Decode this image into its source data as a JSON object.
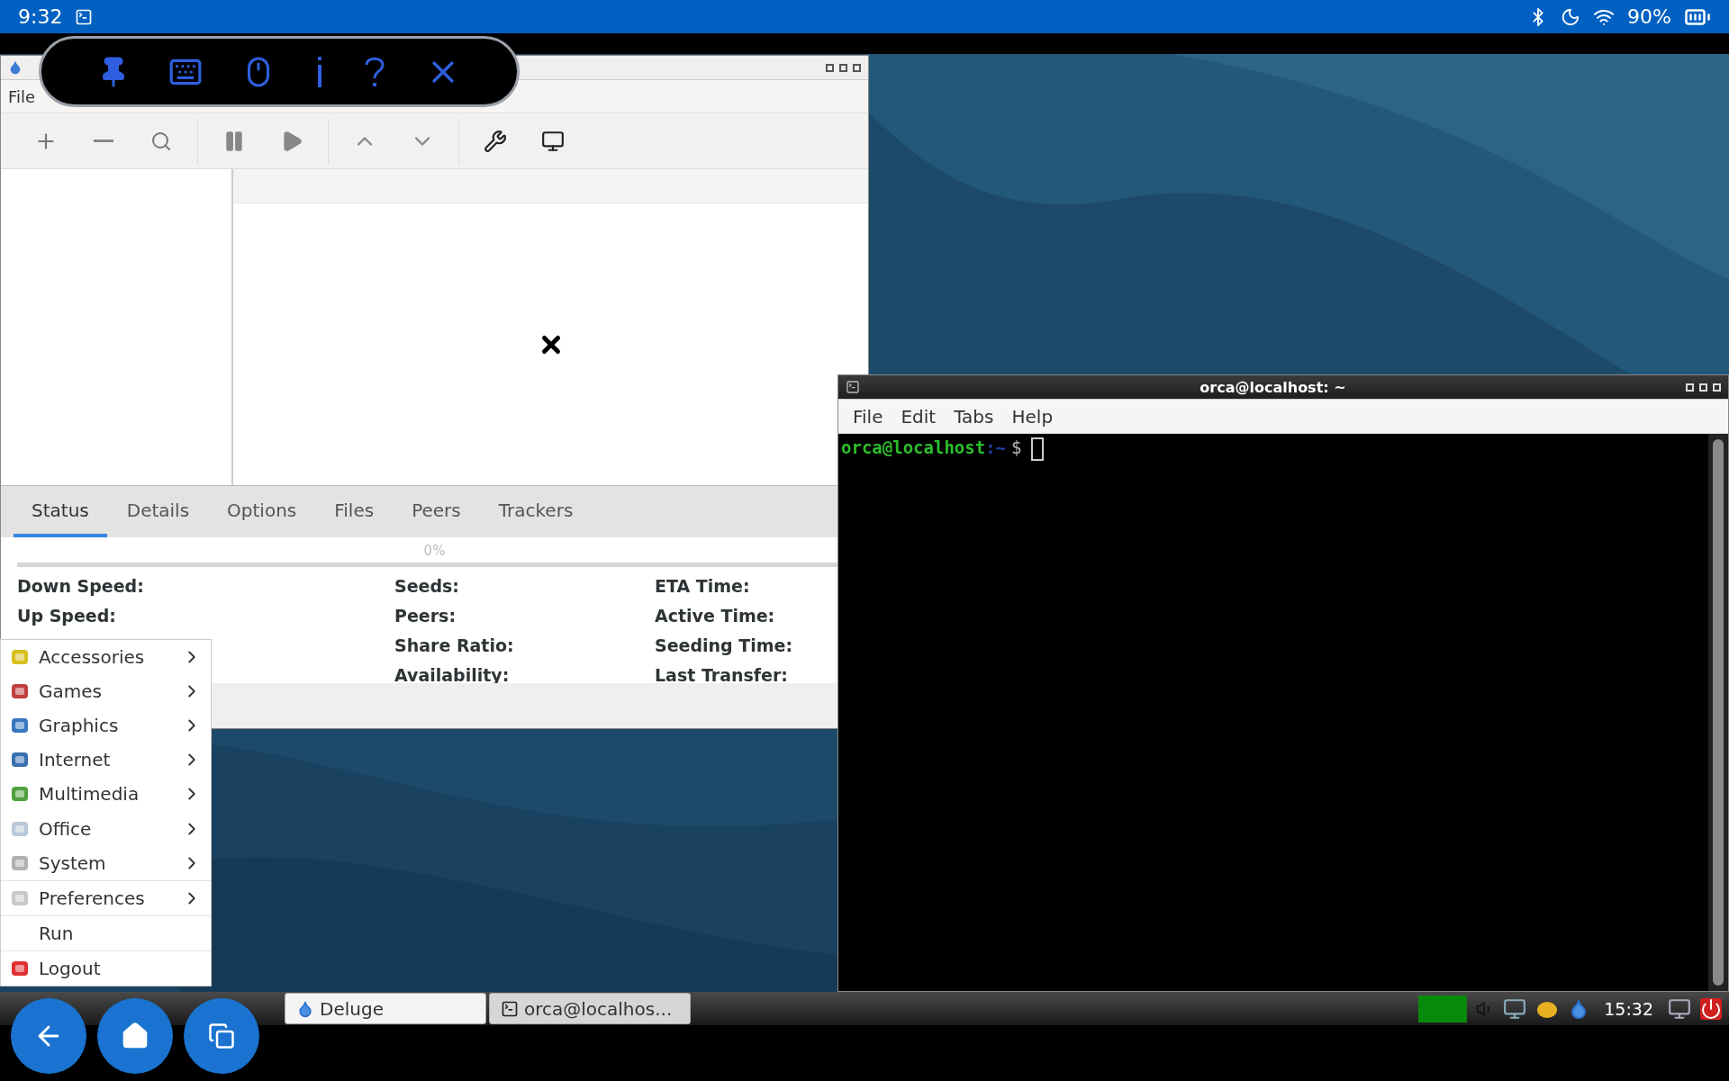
{
  "status_bar": {
    "time": "9:32",
    "battery": "90%"
  },
  "deluge_window": {
    "menu": [
      "File"
    ],
    "tabs": [
      {
        "label": "Status",
        "selected": true
      },
      {
        "label": "Details",
        "selected": false
      },
      {
        "label": "Options",
        "selected": false
      },
      {
        "label": "Files",
        "selected": false
      },
      {
        "label": "Peers",
        "selected": false
      },
      {
        "label": "Trackers",
        "selected": false
      }
    ],
    "progress": {
      "label": "0%",
      "level": 0
    },
    "status_columns": [
      [
        "Down Speed:",
        "Up Speed:"
      ],
      [
        "Seeds:",
        "Peers:",
        "Share Ratio:",
        "Availability:"
      ],
      [
        "ETA Time:",
        "Active Time:",
        "Seeding Time:",
        "Last Transfer:"
      ]
    ]
  },
  "terminal_window": {
    "title": "orca@localhost: ~",
    "menu": [
      "File",
      "Edit",
      "Tabs",
      "Help"
    ],
    "prompt_user": "orca@localhost",
    "prompt_path": ":~",
    "prompt_symbol": "$"
  },
  "app_menu": {
    "items": [
      {
        "label": "Accessories",
        "kind": "submenu",
        "color": "#d8c020"
      },
      {
        "label": "Games",
        "kind": "submenu",
        "color": "#c04040"
      },
      {
        "label": "Graphics",
        "kind": "submenu",
        "color": "#3878c0"
      },
      {
        "label": "Internet",
        "kind": "submenu",
        "color": "#3a70b0"
      },
      {
        "label": "Multimedia",
        "kind": "submenu",
        "color": "#50a040"
      },
      {
        "label": "Office",
        "kind": "submenu",
        "color": "#b8c8d8"
      },
      {
        "label": "System",
        "kind": "submenu",
        "color": "#b0b0b0"
      },
      {
        "label": "Preferences",
        "kind": "submenu",
        "color": "#c8c8c8"
      },
      {
        "label": "Run",
        "kind": "plain"
      },
      {
        "label": "Logout",
        "kind": "plain",
        "color": "#e03030"
      }
    ]
  },
  "taskbar": {
    "tasks": [
      {
        "label": "Deluge",
        "selected": true
      },
      {
        "label": "orca@localhos...",
        "selected": false
      }
    ],
    "clock": "15:32"
  }
}
